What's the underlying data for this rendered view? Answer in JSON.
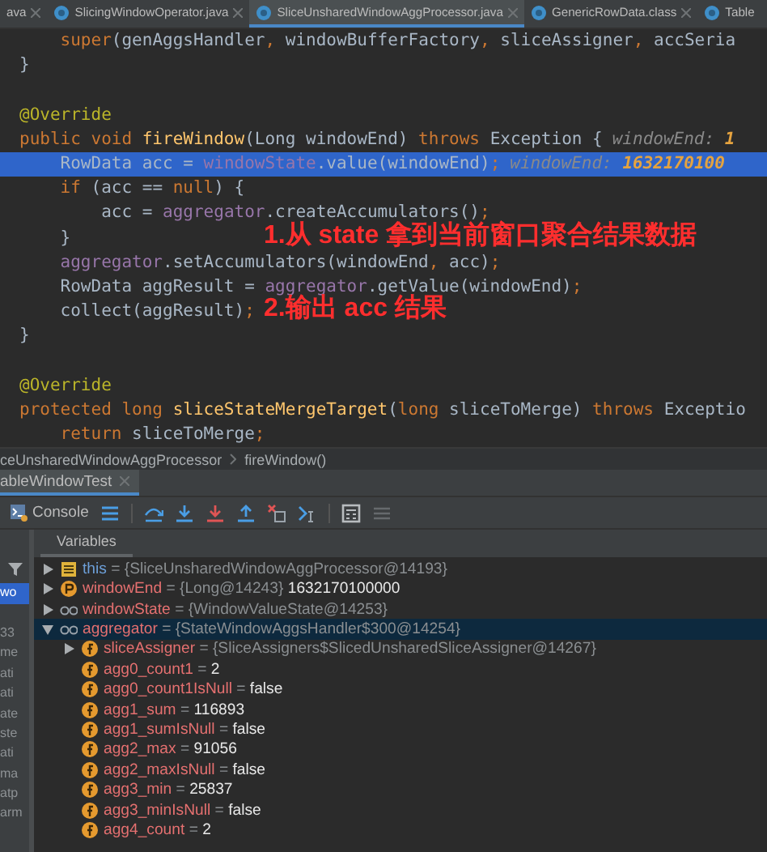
{
  "editor_tabs": [
    {
      "label": "ava",
      "selected": false
    },
    {
      "label": "SlicingWindowOperator.java",
      "selected": false
    },
    {
      "label": "SliceUnsharedWindowAggProcessor.java",
      "selected": true
    },
    {
      "label": "GenericRowData.class",
      "selected": false
    },
    {
      "label": "Table",
      "selected": false
    }
  ],
  "code_lines": [
    {
      "kind": "code",
      "highlighted": false,
      "tokens": [
        {
          "kind": "keyword",
          "text": "    super"
        },
        {
          "kind": "plain",
          "text": "(genAggsHandler"
        },
        {
          "kind": "keyword",
          "text": ", "
        },
        {
          "kind": "plain",
          "text": "windowBufferFactory"
        },
        {
          "kind": "keyword",
          "text": ", "
        },
        {
          "kind": "plain",
          "text": "sliceAssigner"
        },
        {
          "kind": "keyword",
          "text": ", "
        },
        {
          "kind": "plain",
          "text": "accSeria"
        }
      ]
    },
    {
      "kind": "code",
      "highlighted": false,
      "tokens": [
        {
          "kind": "plain",
          "text": "}"
        }
      ]
    },
    {
      "kind": "blank"
    },
    {
      "kind": "code",
      "highlighted": false,
      "tokens": [
        {
          "kind": "annotation",
          "text": "@Override"
        }
      ]
    },
    {
      "kind": "code",
      "highlighted": false,
      "tokens": [
        {
          "kind": "keyword",
          "text": "public void "
        },
        {
          "kind": "method",
          "text": "fireWindow"
        },
        {
          "kind": "plain",
          "text": "(Long windowEnd) "
        },
        {
          "kind": "keyword",
          "text": "throws "
        },
        {
          "kind": "plain",
          "text": "Exception {"
        }
      ],
      "hint": {
        "name": "windowEnd:",
        "value": "1"
      }
    },
    {
      "kind": "code",
      "highlighted": true,
      "tokens": [
        {
          "kind": "plain",
          "text": "    RowData acc = "
        },
        {
          "kind": "field",
          "text": "windowState"
        },
        {
          "kind": "plain",
          "text": ".value(windowEnd)"
        },
        {
          "kind": "keyword",
          "text": ";"
        }
      ],
      "hint": {
        "name": "windowEnd:",
        "value": "1632170100"
      }
    },
    {
      "kind": "code",
      "highlighted": false,
      "tokens": [
        {
          "kind": "keyword",
          "text": "    if "
        },
        {
          "kind": "plain",
          "text": "(acc == "
        },
        {
          "kind": "keyword",
          "text": "null"
        },
        {
          "kind": "plain",
          "text": ") {"
        }
      ]
    },
    {
      "kind": "code",
      "highlighted": false,
      "tokens": [
        {
          "kind": "plain",
          "text": "        acc = "
        },
        {
          "kind": "field",
          "text": "aggregator"
        },
        {
          "kind": "plain",
          "text": ".createAccumulators()"
        },
        {
          "kind": "keyword",
          "text": ";"
        }
      ]
    },
    {
      "kind": "code",
      "highlighted": false,
      "tokens": [
        {
          "kind": "plain",
          "text": "    }"
        }
      ],
      "note": "1.从 state 拿到当前窗口聚合结果数据"
    },
    {
      "kind": "code",
      "highlighted": false,
      "tokens": [
        {
          "kind": "field",
          "text": "    aggregator"
        },
        {
          "kind": "plain",
          "text": ".setAccumulators(windowEnd"
        },
        {
          "kind": "keyword",
          "text": ", "
        },
        {
          "kind": "plain",
          "text": "acc)"
        },
        {
          "kind": "keyword",
          "text": ";"
        }
      ]
    },
    {
      "kind": "code",
      "highlighted": false,
      "tokens": [
        {
          "kind": "plain",
          "text": "    RowData aggResult = "
        },
        {
          "kind": "field",
          "text": "aggregator"
        },
        {
          "kind": "plain",
          "text": ".getValue(windowEnd)"
        },
        {
          "kind": "keyword",
          "text": ";"
        }
      ]
    },
    {
      "kind": "code",
      "highlighted": false,
      "tokens": [
        {
          "kind": "plain",
          "text": "    collect(aggResult)"
        },
        {
          "kind": "keyword",
          "text": ";"
        }
      ],
      "note": "2.输出 acc 结果"
    },
    {
      "kind": "code",
      "highlighted": false,
      "tokens": [
        {
          "kind": "plain",
          "text": "}"
        }
      ]
    },
    {
      "kind": "blank"
    },
    {
      "kind": "code",
      "highlighted": false,
      "tokens": [
        {
          "kind": "annotation",
          "text": "@Override"
        }
      ]
    },
    {
      "kind": "code",
      "highlighted": false,
      "tokens": [
        {
          "kind": "keyword",
          "text": "protected long "
        },
        {
          "kind": "method",
          "text": "sliceStateMergeTarget"
        },
        {
          "kind": "plain",
          "text": "("
        },
        {
          "kind": "keyword",
          "text": "long "
        },
        {
          "kind": "plain",
          "text": "sliceToMerge) "
        },
        {
          "kind": "keyword",
          "text": "throws "
        },
        {
          "kind": "plain",
          "text": "Exceptio"
        }
      ]
    },
    {
      "kind": "code",
      "highlighted": false,
      "tokens": [
        {
          "kind": "keyword",
          "text": "    return "
        },
        {
          "kind": "plain",
          "text": "sliceToMerge"
        },
        {
          "kind": "keyword",
          "text": ";"
        }
      ]
    }
  ],
  "breadcrumb": [
    "ceUnsharedWindowAggProcessor",
    "fireWindow()"
  ],
  "debug_tab": {
    "label": "ableWindowTest"
  },
  "toolbar": {
    "console_label": "Console"
  },
  "variables_tab": {
    "label": "Variables"
  },
  "frames": [
    {
      "label": "wo",
      "selected": true
    },
    {
      "label": "33",
      "selected": false
    },
    {
      "label": "me",
      "selected": false
    },
    {
      "label": "ati",
      "selected": false
    },
    {
      "label": "ati",
      "selected": false
    },
    {
      "label": "ate",
      "selected": false
    },
    {
      "label": "ste",
      "selected": false
    },
    {
      "label": "ati",
      "selected": false
    },
    {
      "label": "ma",
      "selected": false
    },
    {
      "label": "atp",
      "selected": false
    },
    {
      "label": "arm",
      "selected": false
    }
  ],
  "variables": [
    {
      "kind": "object",
      "name": "this",
      "sep": "=",
      "ref": "{SliceUnsharedWindowAggProcessor@14193}",
      "expanded": false,
      "selected": false
    },
    {
      "kind": "param",
      "name": "windowEnd",
      "sep": "=",
      "ref": "{Long@14243}",
      "value": "1632170100000",
      "expanded": false,
      "selected": false
    },
    {
      "kind": "watch",
      "name": "windowState",
      "sep": "=",
      "ref": "{WindowValueState@14253}",
      "expanded": false,
      "selected": false
    },
    {
      "kind": "watch",
      "name": "aggregator",
      "sep": "=",
      "ref": "{StateWindowAggsHandler$300@14254}",
      "expanded": true,
      "selected": true,
      "children": [
        {
          "kind": "field",
          "name": "sliceAssigner",
          "sep": "=",
          "ref": "{SliceAssigners$SlicedUnsharedSliceAssigner@14267}",
          "expanded": false,
          "selected": false
        },
        {
          "kind": "field",
          "name": "agg0_count1",
          "sep": "=",
          "value": "2",
          "selected": false
        },
        {
          "kind": "field",
          "name": "agg0_count1IsNull",
          "sep": "=",
          "value": "false",
          "selected": false
        },
        {
          "kind": "field",
          "name": "agg1_sum",
          "sep": "=",
          "value": "116893",
          "selected": false
        },
        {
          "kind": "field",
          "name": "agg1_sumIsNull",
          "sep": "=",
          "value": "false",
          "selected": false
        },
        {
          "kind": "field",
          "name": "agg2_max",
          "sep": "=",
          "value": "91056",
          "selected": false
        },
        {
          "kind": "field",
          "name": "agg2_maxIsNull",
          "sep": "=",
          "value": "false",
          "selected": false
        },
        {
          "kind": "field",
          "name": "agg3_min",
          "sep": "=",
          "value": "25837",
          "selected": false
        },
        {
          "kind": "field",
          "name": "agg3_minIsNull",
          "sep": "=",
          "value": "false",
          "selected": false
        },
        {
          "kind": "field",
          "name": "agg4_count",
          "sep": "=",
          "value": "2",
          "selected": false
        }
      ]
    }
  ]
}
